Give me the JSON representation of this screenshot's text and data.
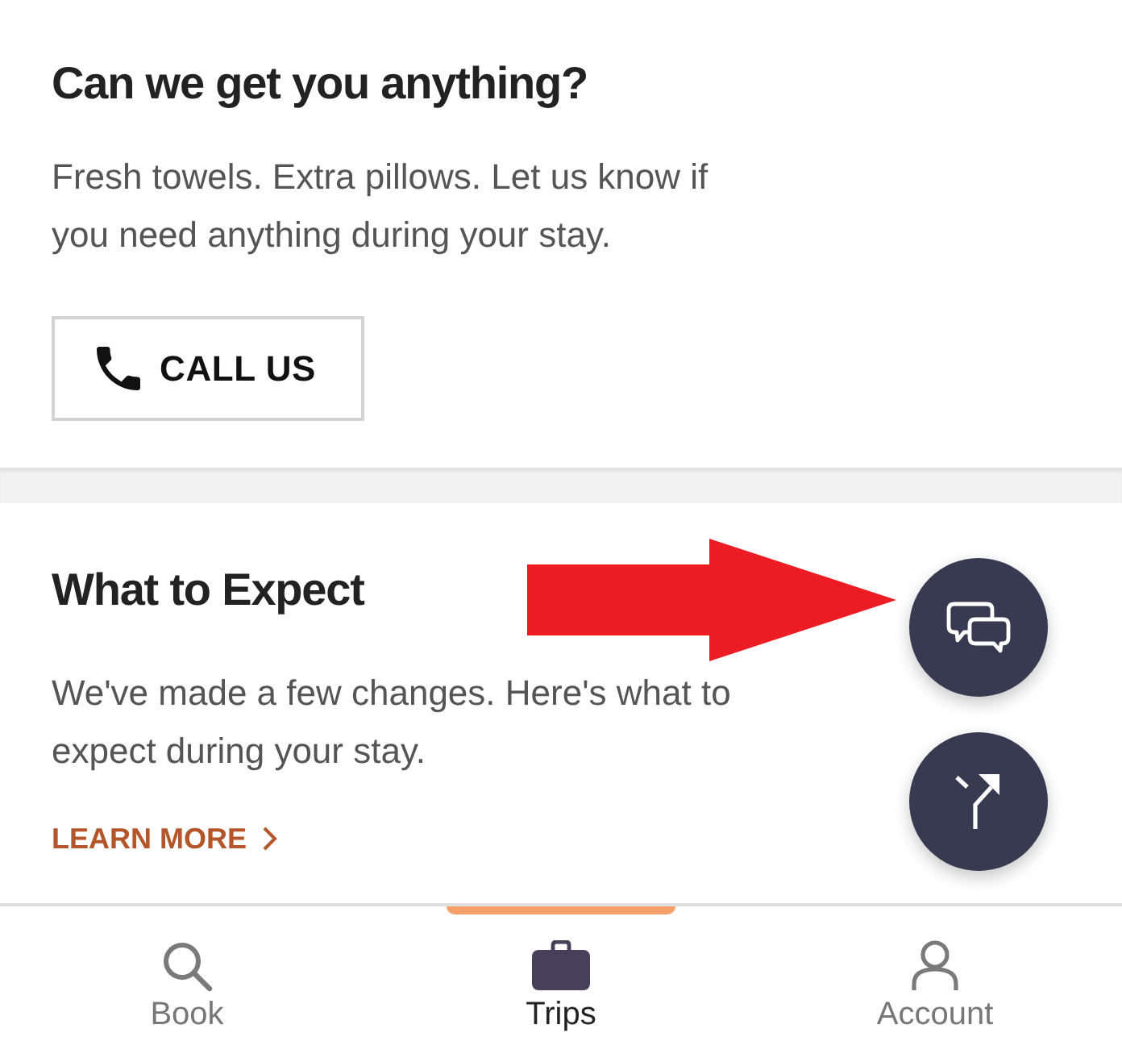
{
  "cards": [
    {
      "title": "Can we get you anything?",
      "body": "Fresh towels. Extra pillows. Let us know if you need anything during your stay.",
      "action": {
        "kind": "button",
        "label": "CALL US"
      }
    },
    {
      "title": "What to Expect",
      "body": "We've made a few changes. Here's what to expect during your stay.",
      "action": {
        "kind": "link",
        "label": "LEARN MORE"
      }
    }
  ],
  "tabs": [
    {
      "label": "Book",
      "selected": false
    },
    {
      "label": "Trips",
      "selected": true
    },
    {
      "label": "Account",
      "selected": false
    }
  ]
}
